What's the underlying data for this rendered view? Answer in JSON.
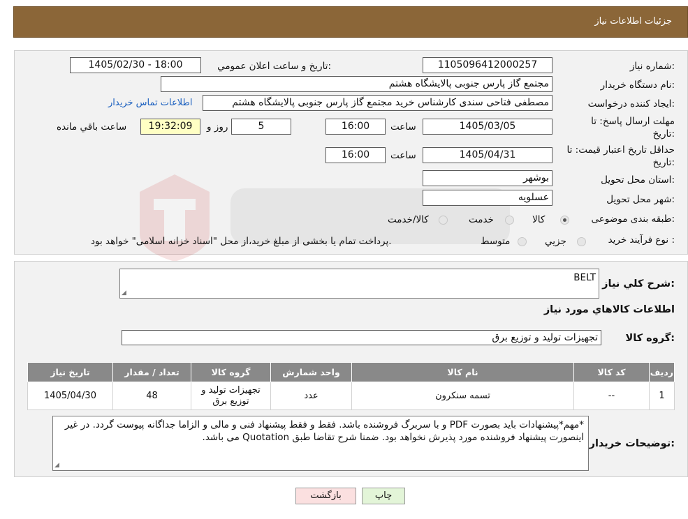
{
  "header": {
    "title": "جزئیات اطلاعات نیاز"
  },
  "need_number": {
    "label": "شماره نیاز:",
    "value": "1105096412000257"
  },
  "announce": {
    "label": "تاریخ و ساعت اعلان عمومي:",
    "value": "1405/02/30 - 18:00"
  },
  "buyer_org": {
    "label": "نام دستگاه خريدار:",
    "value": "مجتمع گاز پارس جنوبی  پالایشگاه هشتم"
  },
  "requester": {
    "label": "ایجاد کننده درخواست:",
    "value": "مصطفی فتاحی سندی کارشناس خرید مجتمع گاز پارس جنوبی  پالایشگاه هشتم",
    "contact_link": "اطلاعات تماس خریدار"
  },
  "reply_deadline": {
    "label_line1": "مهلت ارسال پاسخ: تا",
    "label_line2": "تاریخ:",
    "date": "1405/03/05",
    "time_label": "ساعت",
    "time": "16:00",
    "days": "5",
    "days_label": "روز و",
    "remaining": "19:32:09",
    "remaining_label": "ساعت باقي مانده"
  },
  "price_validity": {
    "label_line1": "حداقل تاریخ اعتبار قیمت: تا",
    "label_line2": "تاریخ:",
    "date": "1405/04/31",
    "time_label": "ساعت",
    "time": "16:00"
  },
  "province": {
    "label": "استان محل تحویل:",
    "value": "بوشهر"
  },
  "city": {
    "label": "شهر محل تحویل:",
    "value": "عسلویه"
  },
  "category": {
    "label": "طبقه بندی موضوعی:",
    "options": [
      "کالا",
      "خدمت",
      "کالا/خدمت"
    ],
    "selected": "کالا"
  },
  "process_type": {
    "label": "نوع فرآیند خرید :",
    "options": [
      "جزیي",
      "متوسط"
    ],
    "note": "پرداخت تمام یا بخشی از مبلغ خرید،از محل \"اسناد خزانه اسلامی\" خواهد بود."
  },
  "general_desc": {
    "label": "شرح كلي نياز:",
    "value": "BELT"
  },
  "goods_info_title": "اطلاعات كالاهاي مورد نياز",
  "goods_group": {
    "label": "گروه کالا:",
    "value": "تجهیزات تولید و توزیع برق"
  },
  "table": {
    "headers": [
      "رديف",
      "کد کالا",
      "نام کالا",
      "واحد شمارش",
      "گروه کالا",
      "تعداد / مقدار",
      "تاریخ نیاز"
    ],
    "rows": [
      [
        "1",
        "--",
        "تسمه سنکرون",
        "عدد",
        "تجهیزات تولید و توزیع برق",
        "48",
        "1405/04/30"
      ]
    ]
  },
  "buyer_notes": {
    "label": "توضیحات خریدار:",
    "value": "*مهم*پیشنهادات باید بصورت PDF و با سربرگ فروشنده باشد. فقط و فقط پیشنهاد فنی و مالی و الزاما جداگانه پیوست گردد. در غیر اینصورت پیشنهاد فروشنده مورد پذیرش نخواهد بود. ضمنا شرح تقاضا طبق Quotation می باشد."
  },
  "buttons": {
    "print": "چاپ",
    "back": "بازگشت"
  },
  "colors": {
    "header": "#8b6638",
    "table_header": "#898989",
    "link": "#1a5fbf",
    "print_btn": "#e3f5d8",
    "back_btn": "#fbe0e0"
  }
}
